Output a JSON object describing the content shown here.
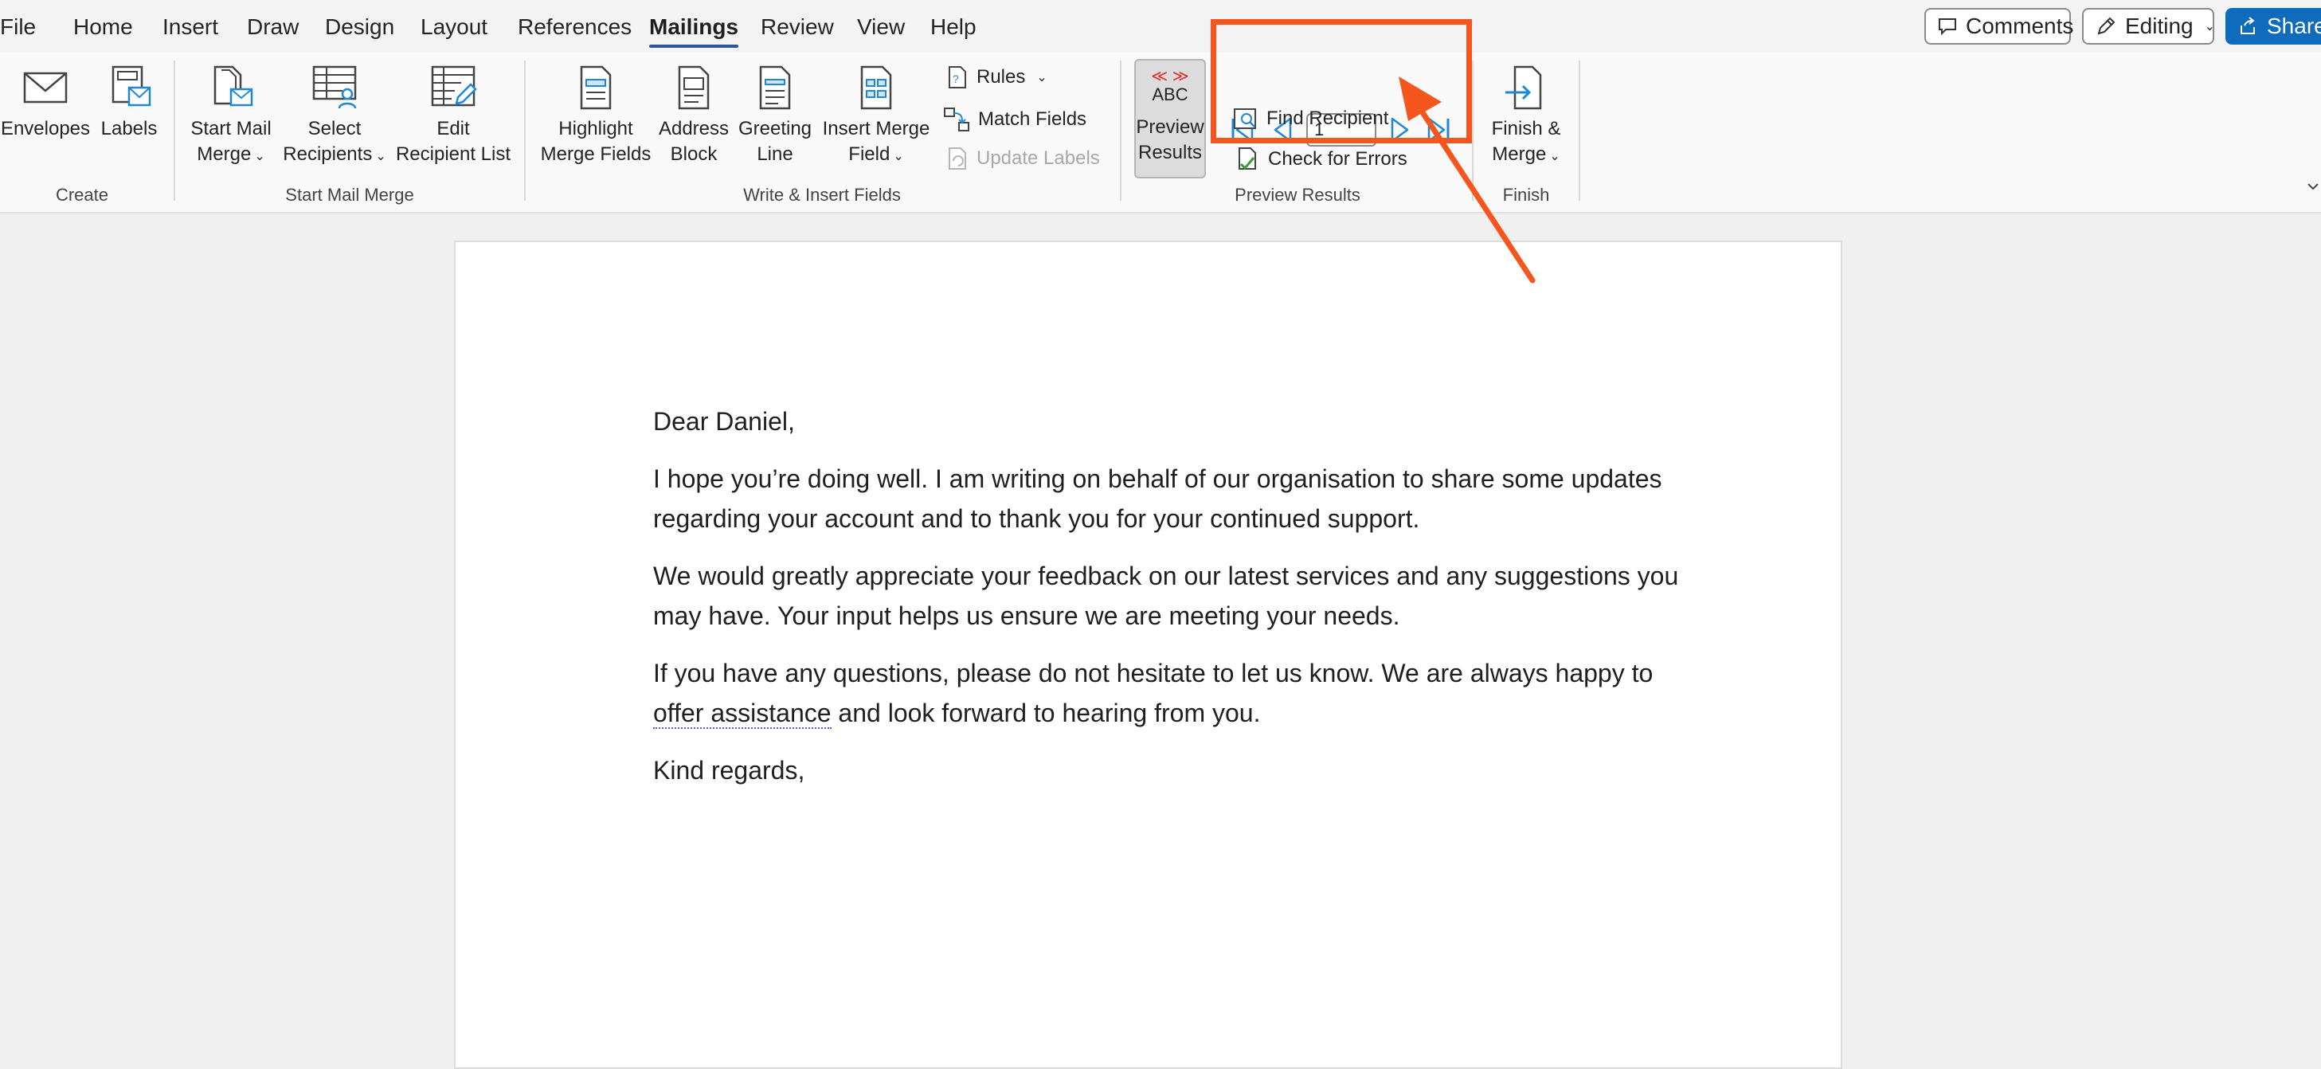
{
  "tabs": [
    "File",
    "Home",
    "Insert",
    "Draw",
    "Design",
    "Layout",
    "References",
    "Mailings",
    "Review",
    "View",
    "Help"
  ],
  "active_tab": "Mailings",
  "top_right": {
    "comments": "Comments",
    "editing": "Editing",
    "share": "Share"
  },
  "ribbon": {
    "create": {
      "group_label": "Create",
      "envelopes": "Envelopes",
      "labels": "Labels"
    },
    "start_mail_merge": {
      "group_label": "Start Mail Merge",
      "start_mail_merge_line1": "Start Mail",
      "start_mail_merge_line2": "Merge",
      "select_recipients_line1": "Select",
      "select_recipients_line2": "Recipients",
      "edit_recipient_list_line1": "Edit",
      "edit_recipient_list_line2": "Recipient List"
    },
    "write_insert": {
      "group_label": "Write & Insert Fields",
      "highlight_line1": "Highlight",
      "highlight_line2": "Merge Fields",
      "address_line1": "Address",
      "address_line2": "Block",
      "greeting_line1": "Greeting",
      "greeting_line2": "Line",
      "insert_merge_line1": "Insert Merge",
      "insert_merge_line2": "Field",
      "rules": "Rules",
      "match_fields": "Match Fields",
      "update_labels": "Update Labels"
    },
    "preview": {
      "group_label": "Preview Results",
      "preview_icon_text": "ABC",
      "preview_line1": "Preview",
      "preview_line2": "Results",
      "record_number": "1",
      "find_recipient": "Find Recipient",
      "check_errors": "Check for Errors"
    },
    "finish": {
      "group_label": "Finish",
      "finish_line1": "Finish &",
      "finish_line2": "Merge"
    }
  },
  "document": {
    "greeting": "Dear Daniel,",
    "para1": "I hope you’re doing well. I am writing on behalf of our organisation to share some updates regarding your account and to thank you for your continued support.",
    "para2": "We would greatly appreciate your feedback on our latest services and any suggestions you may have. Your input helps us ensure we are meeting your needs.",
    "para3_before": "If you have any questions, please do not hesitate to let us know. We are always happy to ",
    "para3_marked": "offer assistance",
    "para3_after": " and look forward to hearing from you.",
    "closing": "Kind regards,"
  },
  "colors": {
    "accent": "#2b579a",
    "nav_arrow": "#1e88d6",
    "annotation": "#f5561e",
    "share_bg": "#0f6cbd"
  }
}
